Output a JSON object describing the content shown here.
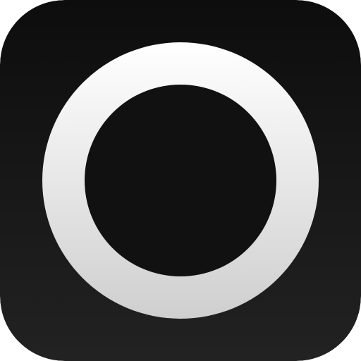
{
  "icon": {
    "name": "ring-app-icon",
    "background_top_color": "#0d0d0d",
    "background_bottom_color": "#222222",
    "ring_top_color": "#ffffff",
    "ring_bottom_color": "#cfcfcf",
    "inner_color": "#111111"
  }
}
